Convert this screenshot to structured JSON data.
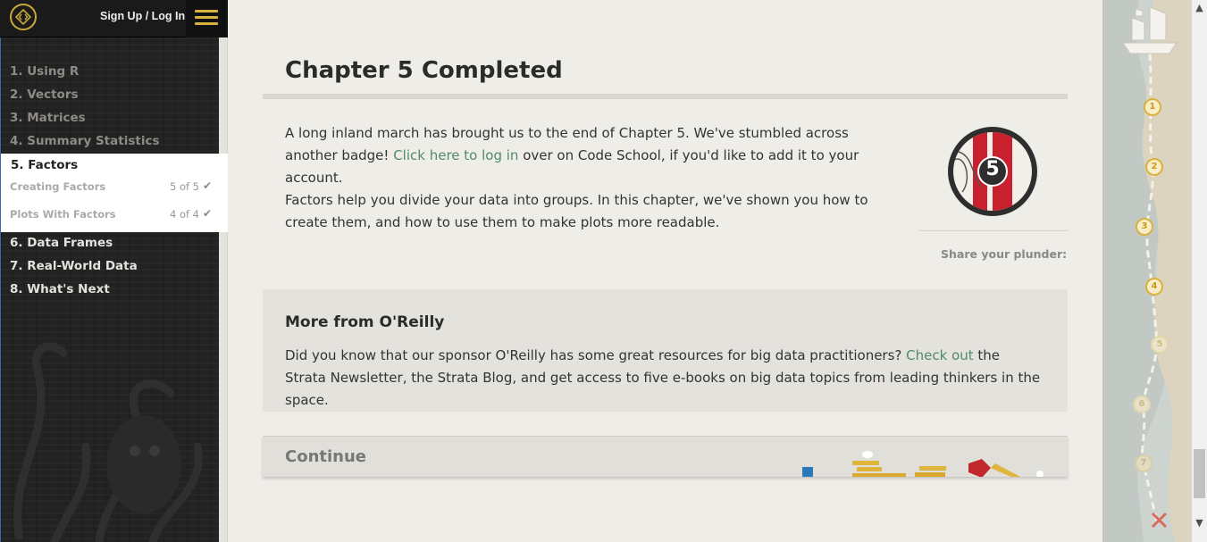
{
  "header": {
    "signup_label": "Sign Up / Log In",
    "logo_icon": "code-school-logo",
    "menu_icon": "hamburger-menu-icon"
  },
  "sidebar": {
    "chapters": [
      {
        "label": "1. Using R"
      },
      {
        "label": "2. Vectors"
      },
      {
        "label": "3. Matrices"
      },
      {
        "label": "4. Summary Statistics"
      },
      {
        "label": "5. Factors"
      },
      {
        "label": "6. Data Frames"
      },
      {
        "label": "7. Real-World Data"
      },
      {
        "label": "8. What's Next"
      }
    ],
    "sub_items": [
      {
        "label": "Creating Factors",
        "count": "5 of 5"
      },
      {
        "label": "Plots With Factors",
        "count": "4 of 4"
      }
    ]
  },
  "main": {
    "title": "Chapter 5 Completed",
    "para1_a": "A long inland march has brought us to the end of Chapter 5. We've stumbled across another badge! ",
    "para1_link": "Click here to log in",
    "para1_b": " over on Code School, if you'd like to add it to your account.",
    "para2": "Factors help you divide your data into groups. In this chapter, we've shown you how to create them, and how to use them to make plots more readable.",
    "badge_number": "5",
    "share_label": "Share your plunder:",
    "oreilly": {
      "title": "More from O'Reilly",
      "body_a": "Did you know that our sponsor O'Reilly has some great resources for big data practitioners? ",
      "body_link": "Check out",
      "body_b": " the Strata Newsletter, the Strata Blog, and get access to five e-books on big data topics from leading thinkers in the space."
    },
    "continue_label": "Continue"
  },
  "map": {
    "markers": [
      "1",
      "2",
      "3",
      "4",
      "5",
      "6",
      "7"
    ],
    "completed_color": "#d8b23c",
    "pending_color": "#c6c09a"
  },
  "colors": {
    "accent": "#d8b23c",
    "link": "#4f8a6b",
    "sidebar_bg": "#222222"
  }
}
